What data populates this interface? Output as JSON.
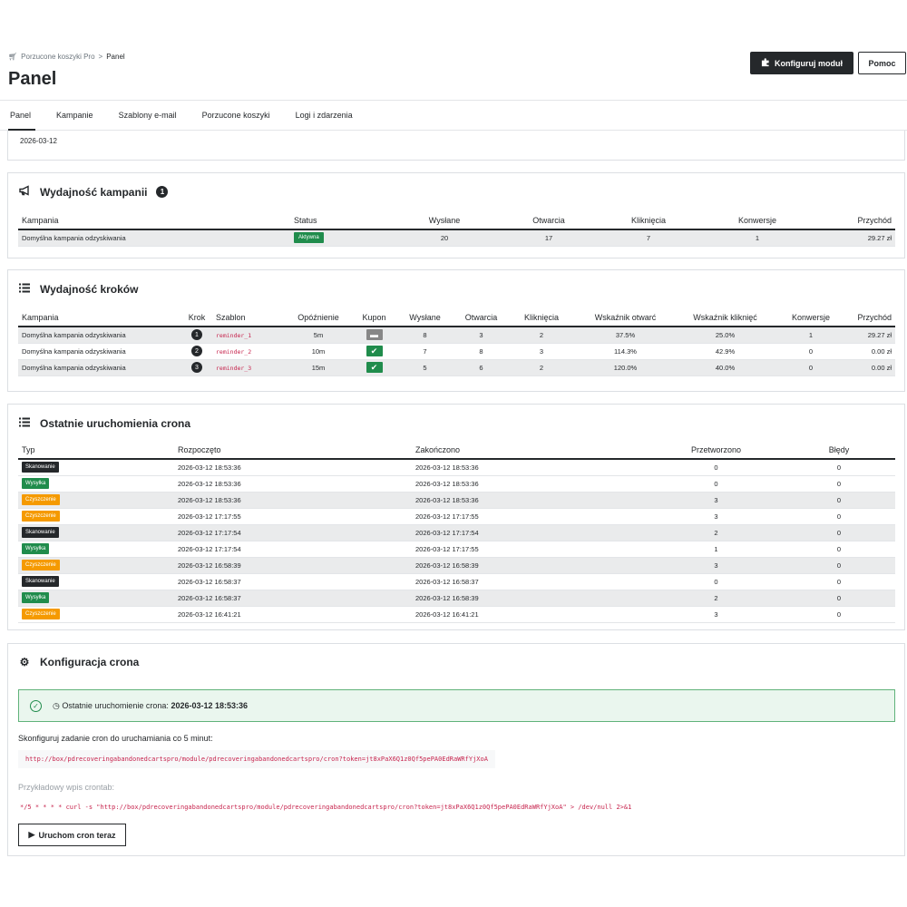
{
  "breadcrumb": {
    "parent": "Porzucone koszyki Pro",
    "separator": ">",
    "current": "Panel"
  },
  "page": {
    "title": "Panel"
  },
  "toolbar": {
    "configure_label": "Konfiguruj moduł",
    "help_label": "Pomoc"
  },
  "tabs": [
    {
      "label": "Panel",
      "active": true
    },
    {
      "label": "Kampanie"
    },
    {
      "label": "Szablony e-mail"
    },
    {
      "label": "Porzucone koszyki"
    },
    {
      "label": "Logi i zdarzenia"
    }
  ],
  "top_card": {
    "date": "2026-03-12"
  },
  "campaign_perf": {
    "title": "Wydajność kampanii",
    "count": "1",
    "headers": [
      "Kampania",
      "Status",
      "Wysłane",
      "Otwarcia",
      "Kliknięcia",
      "Konwersje",
      "Przychód"
    ],
    "rows": [
      {
        "name": "Domyślna kampania odzyskiwania",
        "status": "Aktywna",
        "sent": "20",
        "opens": "17",
        "clicks": "7",
        "conversions": "1",
        "revenue": "29.27 zł"
      }
    ]
  },
  "step_perf": {
    "title": "Wydajność kroków",
    "headers": [
      "Kampania",
      "Krok",
      "Szablon",
      "Opóźnienie",
      "Kupon",
      "Wysłane",
      "Otwarcia",
      "Kliknięcia",
      "Wskaźnik otwarć",
      "Wskaźnik kliknięć",
      "Konwersje",
      "Przychód"
    ],
    "rows": [
      {
        "campaign": "Domyślna kampania odzyskiwania",
        "step": "1",
        "template": "reminder_1",
        "delay": "5m",
        "coupon": "off",
        "sent": "8",
        "opens": "3",
        "clicks": "2",
        "open_rate": "37.5%",
        "click_rate": "25.0%",
        "conversions": "1",
        "revenue": "29.27 zł"
      },
      {
        "campaign": "Domyślna kampania odzyskiwania",
        "step": "2",
        "template": "reminder_2",
        "delay": "10m",
        "coupon": "on",
        "sent": "7",
        "opens": "8",
        "clicks": "3",
        "open_rate": "114.3%",
        "click_rate": "42.9%",
        "conversions": "0",
        "revenue": "0.00 zł"
      },
      {
        "campaign": "Domyślna kampania odzyskiwania",
        "step": "3",
        "template": "reminder_3",
        "delay": "15m",
        "coupon": "on",
        "sent": "5",
        "opens": "6",
        "clicks": "2",
        "open_rate": "120.0%",
        "click_rate": "40.0%",
        "conversions": "0",
        "revenue": "0.00 zł"
      }
    ]
  },
  "cron_runs": {
    "title": "Ostatnie uruchomienia crona",
    "headers": [
      "Typ",
      "Rozpoczęto",
      "Zakończono",
      "Przetworzono",
      "Błędy"
    ],
    "rows": [
      {
        "type": "Skanowanie",
        "kind": "scan",
        "started": "2026-03-12 18:53:36",
        "finished": "2026-03-12 18:53:36",
        "processed": "0",
        "errors": "0"
      },
      {
        "type": "Wysyłka",
        "kind": "send",
        "started": "2026-03-12 18:53:36",
        "finished": "2026-03-12 18:53:36",
        "processed": "0",
        "errors": "0"
      },
      {
        "type": "Czyszczenie",
        "kind": "clean",
        "started": "2026-03-12 18:53:36",
        "finished": "2026-03-12 18:53:36",
        "processed": "3",
        "errors": "0"
      },
      {
        "type": "Czyszczenie",
        "kind": "clean",
        "started": "2026-03-12 17:17:55",
        "finished": "2026-03-12 17:17:55",
        "processed": "3",
        "errors": "0"
      },
      {
        "type": "Skanowanie",
        "kind": "scan",
        "started": "2026-03-12 17:17:54",
        "finished": "2026-03-12 17:17:54",
        "processed": "2",
        "errors": "0"
      },
      {
        "type": "Wysyłka",
        "kind": "send",
        "started": "2026-03-12 17:17:54",
        "finished": "2026-03-12 17:17:55",
        "processed": "1",
        "errors": "0"
      },
      {
        "type": "Czyszczenie",
        "kind": "clean",
        "started": "2026-03-12 16:58:39",
        "finished": "2026-03-12 16:58:39",
        "processed": "3",
        "errors": "0"
      },
      {
        "type": "Skanowanie",
        "kind": "scan",
        "started": "2026-03-12 16:58:37",
        "finished": "2026-03-12 16:58:37",
        "processed": "0",
        "errors": "0"
      },
      {
        "type": "Wysyłka",
        "kind": "send",
        "started": "2026-03-12 16:58:37",
        "finished": "2026-03-12 16:58:39",
        "processed": "2",
        "errors": "0"
      },
      {
        "type": "Czyszczenie",
        "kind": "clean",
        "started": "2026-03-12 16:41:21",
        "finished": "2026-03-12 16:41:21",
        "processed": "3",
        "errors": "0"
      }
    ]
  },
  "cron_config": {
    "title": "Konfiguracja crona",
    "last_run_label": "Ostatnie uruchomienie crona:",
    "last_run_value": "2026-03-12 18:53:36",
    "instruction": "Skonfiguruj zadanie cron do uruchamiania co 5 minut:",
    "url": "http://box/pdrecoveringabandonedcartspro/module/pdrecoveringabandonedcartspro/cron?token=jt8xPaX6Q1z0Qf5pePA0EdRaWRfYjXoA",
    "crontab_label": "Przykładowy wpis crontab:",
    "crontab": "*/5 * * * * curl -s \"http://box/pdrecoveringabandonedcartspro/module/pdrecoveringabandonedcartspro/cron?token=jt8xPaX6Q1z0Qf5pePA0EdRaWRfYjXoA\" > /dev/null 2>&1",
    "run_button": "Uruchom cron teraz"
  },
  "colors": {
    "dark": "#25282b",
    "success": "#208c4c",
    "warning": "#f59a00",
    "muted": "#878787",
    "code": "#c7254e"
  }
}
